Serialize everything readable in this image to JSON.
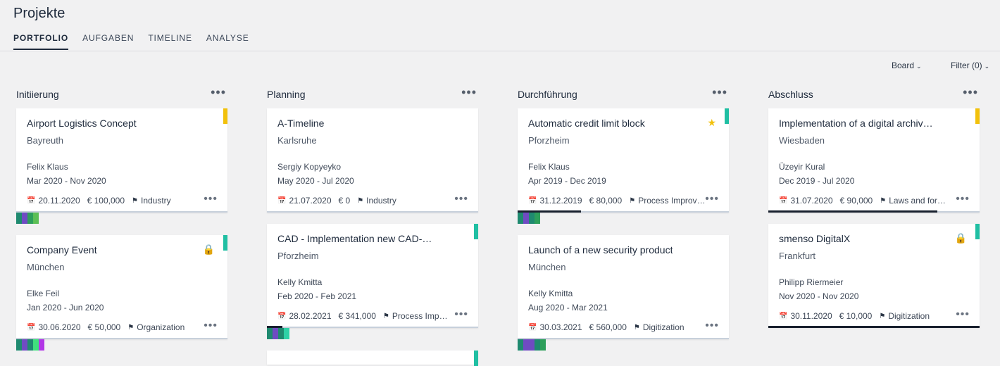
{
  "header": {
    "title": "Projekte"
  },
  "tabs": [
    "PORTFOLIO",
    "AUFGABEN",
    "TIMELINE",
    "ANALYSE"
  ],
  "controls": {
    "board": "Board",
    "filter": "Filter (0)"
  },
  "columns": [
    {
      "title": "Initiierung",
      "cards": [
        {
          "name": "Airport Logistics Concept",
          "city": "Bayreuth",
          "person": "Felix Klaus",
          "period": "Mar 2020 - Nov 2020",
          "date": "20.11.2020",
          "budget": "€ 100,000",
          "tag": "Industry",
          "accent": "#f2c10b"
        },
        {
          "name": "Company Event",
          "city": "München",
          "person": "Elke Feil",
          "period": "Jan 2020 - Jun 2020",
          "date": "30.06.2020",
          "budget": "€ 50,000",
          "tag": "Organization",
          "accent": "#20bfa3",
          "icon": "lock-icon"
        }
      ]
    },
    {
      "title": "Planning",
      "cards": [
        {
          "name": "A-Timeline",
          "city": "Karlsruhe",
          "person": "Sergiy Kopyeyko",
          "period": "May 2020 - Jul 2020",
          "date": "21.07.2020",
          "budget": "€ 0",
          "tag": "Industry",
          "accent": ""
        },
        {
          "name": "CAD - Implementation new CAD-System",
          "city": "Pforzheim",
          "person": "Kelly Kmitta",
          "period": "Feb 2020 - Feb 2021",
          "date": "28.02.2021",
          "budget": "€ 341,000",
          "tag": "Process Improvement",
          "accent": "#20bfa3"
        }
      ]
    },
    {
      "title": "Durchführung",
      "cards": [
        {
          "name": "Automatic credit limit block",
          "city": "Pforzheim",
          "person": "Felix Klaus",
          "period": "Apr 2019 - Dec 2019",
          "date": "31.12.2019",
          "budget": "€ 80,000",
          "tag": "Process Improvement",
          "accent": "#20bfa3",
          "icon": "star-icon"
        },
        {
          "name": "Launch of a new security product",
          "city": "München",
          "person": "Kelly Kmitta",
          "period": "Aug 2020 - Mar 2021",
          "date": "30.03.2021",
          "budget": "€ 560,000",
          "tag": "Digitization",
          "accent": ""
        }
      ]
    },
    {
      "title": "Abschluss",
      "cards": [
        {
          "name": "Implementation of a digital archive system",
          "city": "Wiesbaden",
          "person": "Üzeyir Kural",
          "period": "Dec 2019 - Jul 2020",
          "date": "31.07.2020",
          "budget": "€ 90,000",
          "tag": "Laws and formalities",
          "accent": "#f2c10b"
        },
        {
          "name": "smenso DigitalX",
          "city": "Frankfurt",
          "person": "Philipp Riermeier",
          "period": "Nov 2020 - Nov 2020",
          "date": "30.11.2020",
          "budget": "€ 10,000",
          "tag": "Digitization",
          "accent": "#20bfa3",
          "icon": "lock-icon"
        }
      ]
    }
  ],
  "colors": {
    "yellow": "#f2c10b",
    "teal": "#20bfa3",
    "dark": "#18202e",
    "line": "#c7d0db"
  }
}
